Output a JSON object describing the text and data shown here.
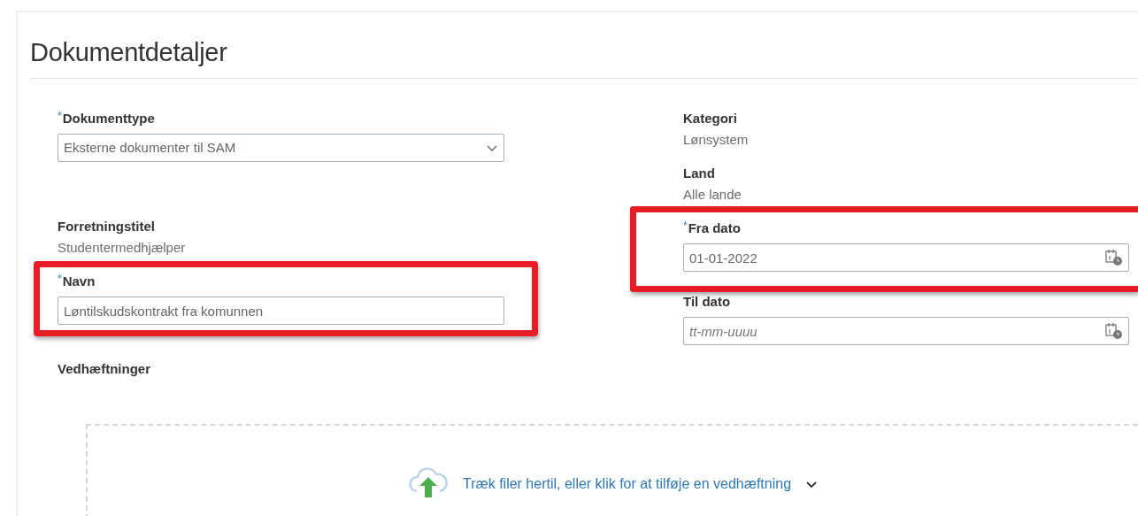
{
  "title": "Dokumentdetaljer",
  "left_fields": [
    {
      "kind": "select",
      "label": "$^{*}$Dokumenttype",
      "value": "Eksterne dokumenter til SAM",
      "highlighted": false
    },
    {
      "kind": "readonly",
      "label": "Forretningstitel",
      "value": "Studentermedhjælper",
      "highlighted": false
    },
    {
      "kind": "text",
      "label": "$^{*}$Navn",
      "value": "Løntilskudskontrakt fra komunnen",
      "highlighted": true
    }
  ],
  "attachments": {
    "label": "Vedhæftninger",
    "dropzone_text": "Træk filer hertil, eller klik for at tilføje en vedhæftning"
  },
  "right_fields": [
    {
      "kind": "readonly",
      "label": "Kategori",
      "value": "Lønsystem",
      "highlighted": false
    },
    {
      "kind": "readonly",
      "label": "Land",
      "value": "Alle lande",
      "highlighted": false
    },
    {
      "kind": "date",
      "label": "$^{*}$Fra dato",
      "value": "01-01-2022",
      "highlighted": true
    },
    {
      "kind": "date",
      "label": "Til dato",
      "placeholder": "tt-mm-uuuu",
      "highlighted": false
    }
  ]
}
